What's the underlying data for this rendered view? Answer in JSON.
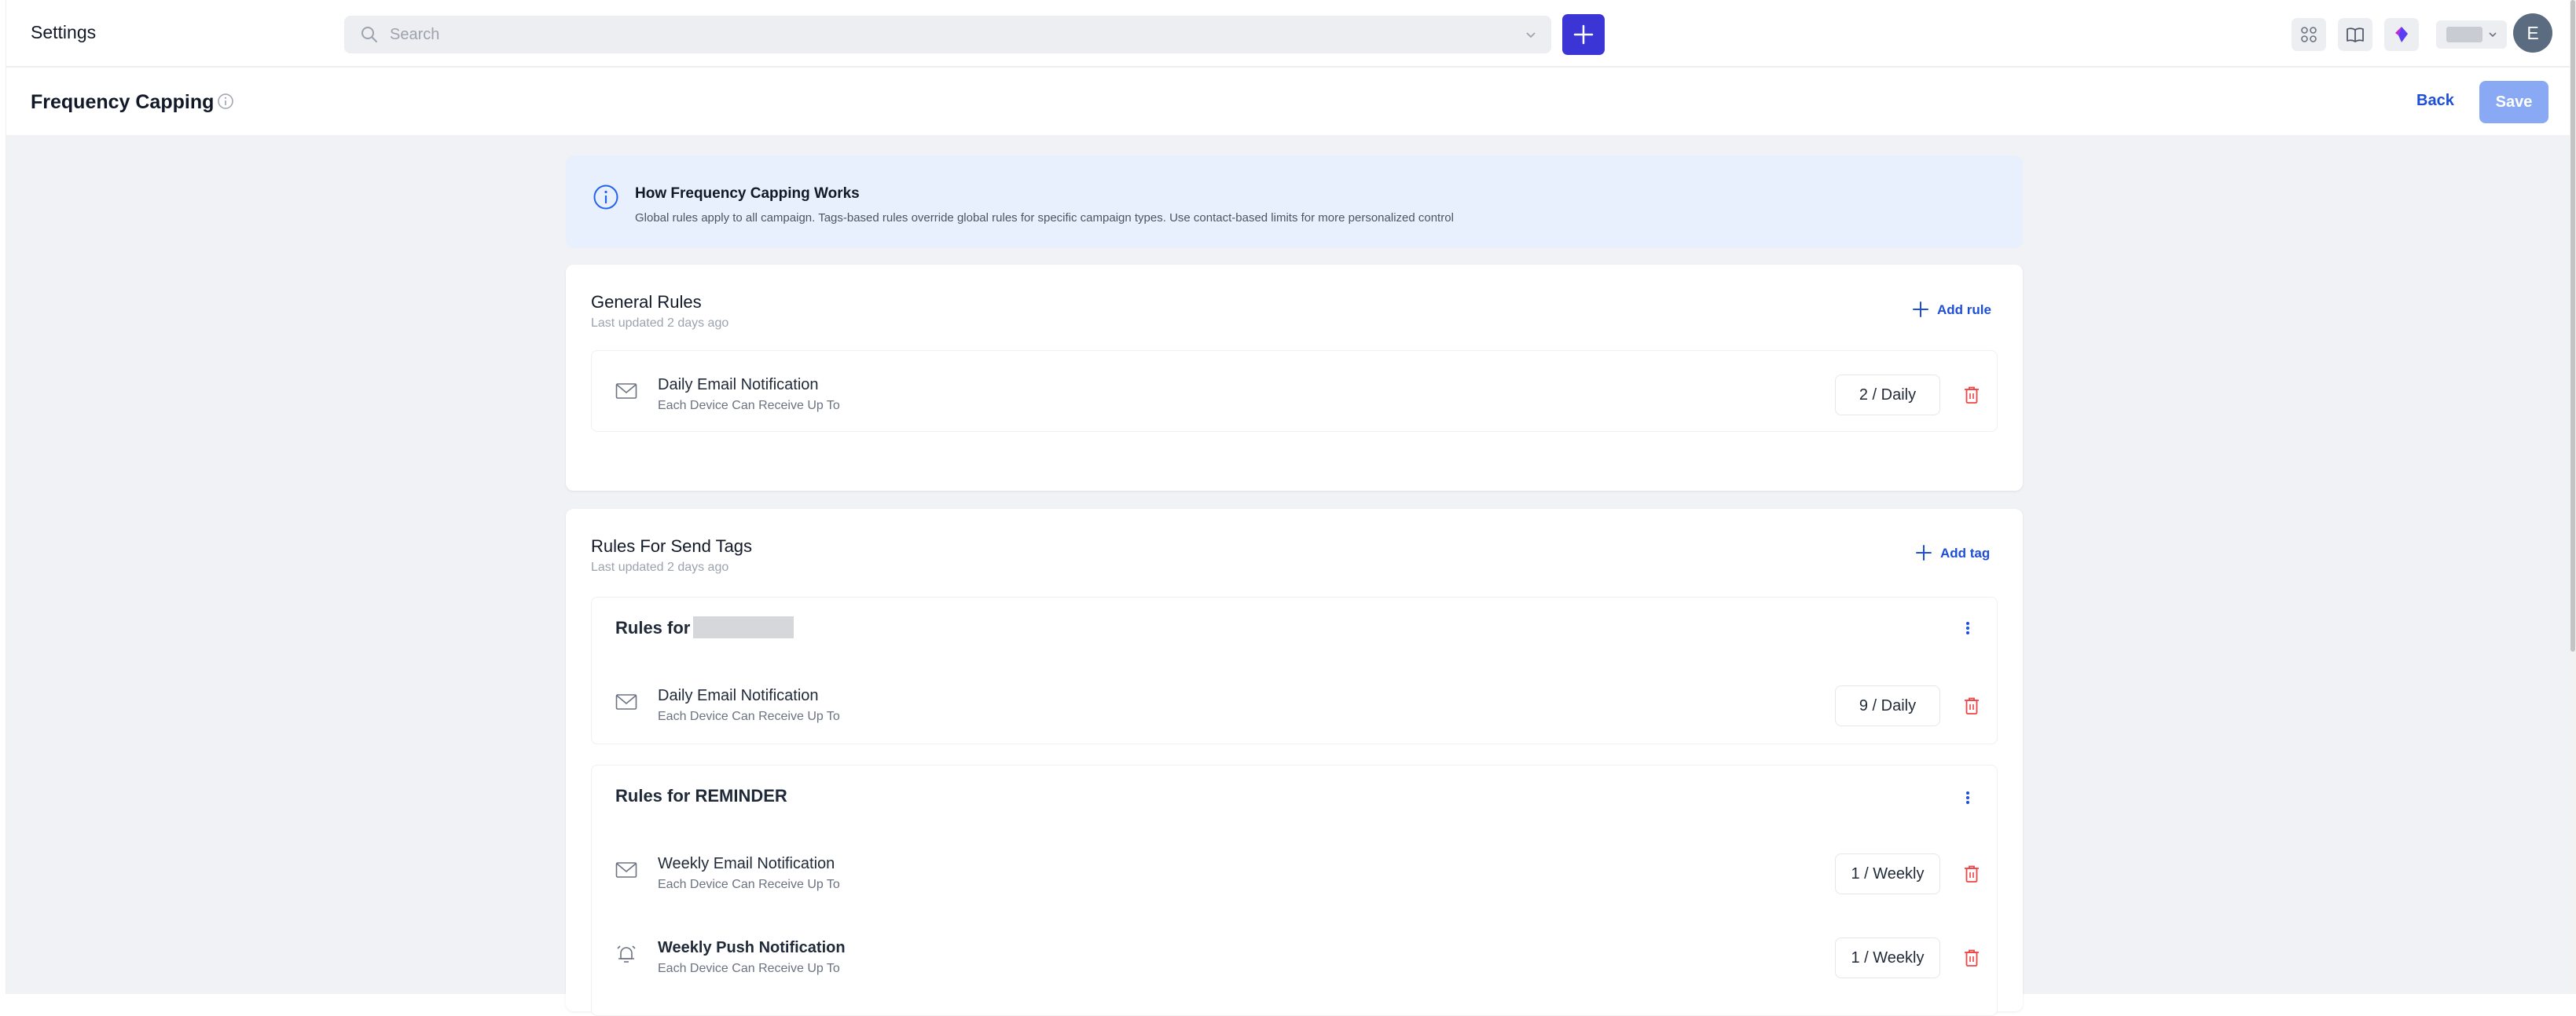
{
  "topbar": {
    "app_title": "Settings",
    "search_placeholder": "Search",
    "avatar_initial": "E"
  },
  "page": {
    "title": "Frequency Capping",
    "back_label": "Back",
    "save_label": "Save"
  },
  "info_banner": {
    "title": "How Frequency Capping Works",
    "text": "Global rules apply to all campaign. Tags-based rules override global rules for specific campaign types. Use contact-based limits for more personalized control"
  },
  "general_rules": {
    "title": "General Rules",
    "updated": "Last updated 2 days ago",
    "add_label": "Add rule",
    "rules": [
      {
        "icon": "envelope-icon",
        "name": "Daily Email Notification",
        "desc": "Each Device Can Receive Up To",
        "limit": "2 / Daily"
      }
    ]
  },
  "send_tags": {
    "title": "Rules For Send Tags",
    "updated": "Last updated 2 days ago",
    "add_label": "Add tag",
    "groups": [
      {
        "title": "Rules for",
        "rules": [
          {
            "icon": "envelope-icon",
            "name": "Daily Email Notification",
            "desc": "Each Device Can Receive Up To",
            "limit": "9 / Daily"
          }
        ]
      },
      {
        "title": "Rules for REMINDER",
        "rules": [
          {
            "icon": "envelope-icon",
            "name": "Weekly Email Notification",
            "desc": "Each Device Can Receive Up To",
            "limit": "1 / Weekly"
          },
          {
            "icon": "alarm-bell-icon",
            "name": "Weekly Push Notification",
            "desc": "Each Device Can Receive Up To",
            "limit": "1 / Weekly"
          }
        ]
      }
    ]
  },
  "colors": {
    "accent": "#3b35d6",
    "link": "#1d4ed8",
    "save_disabled": "#8aa9f5",
    "delete": "#ef4444",
    "banner_bg": "#e8f0fd",
    "page_bg": "#f0f2f5"
  }
}
